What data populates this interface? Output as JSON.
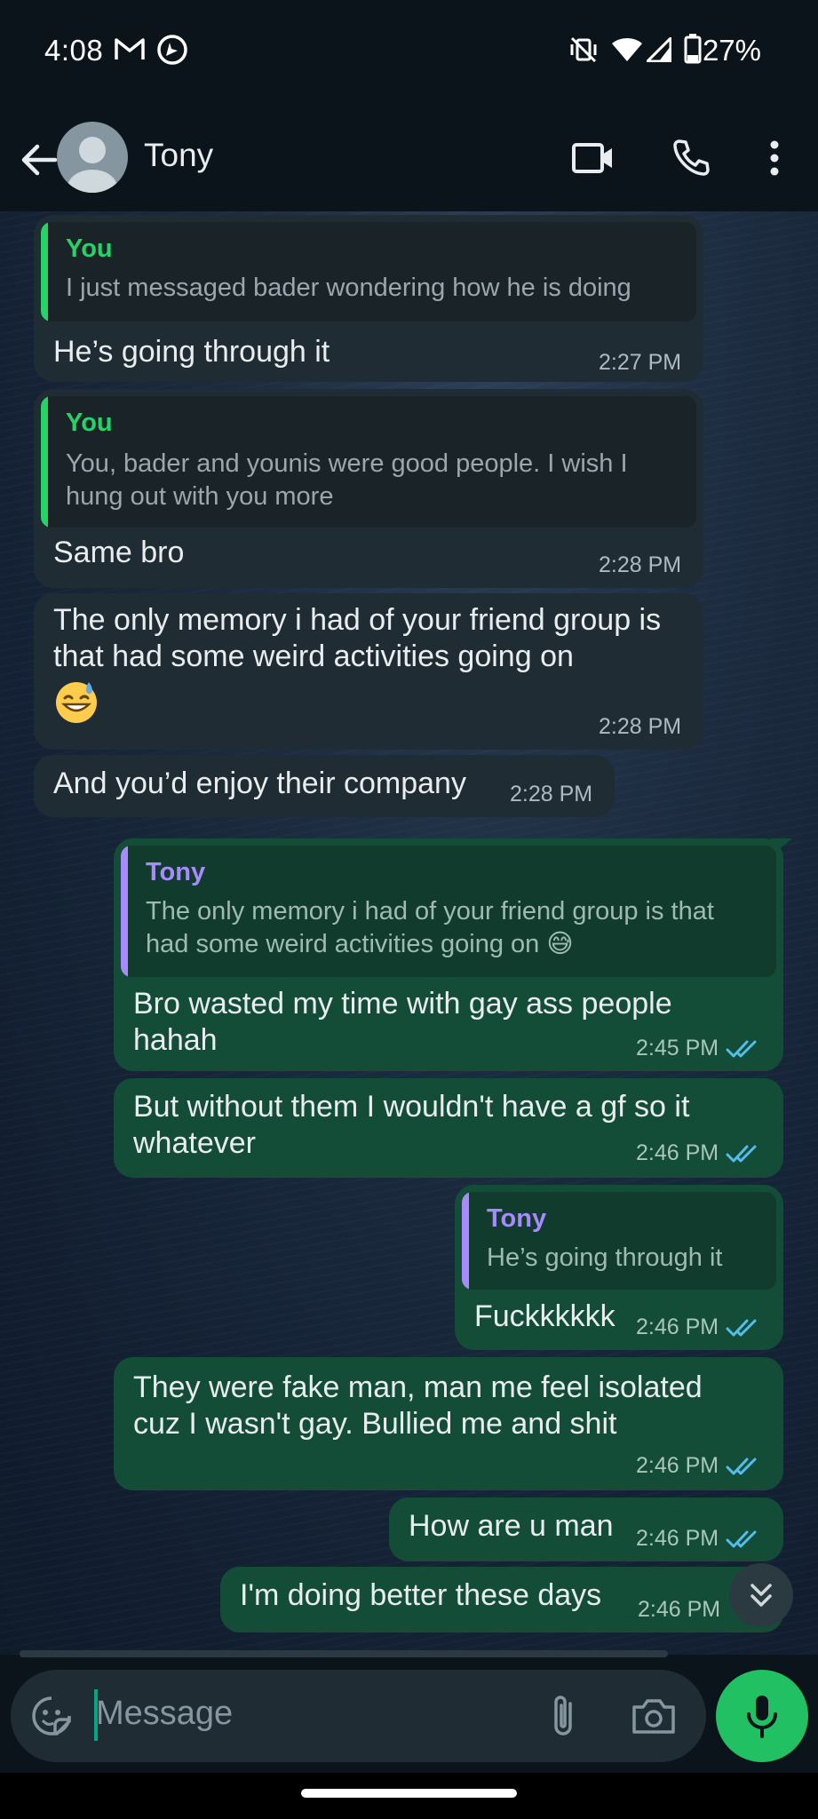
{
  "status_bar": {
    "time": "4:08",
    "battery": "27%"
  },
  "app_bar": {
    "contact_name": "Tony"
  },
  "messages": [
    {
      "dir": "in",
      "quote_author": "You",
      "quote_text": "I just messaged bader wondering how he is doing",
      "text": "He’s going through it",
      "time": "2:27 PM"
    },
    {
      "dir": "in",
      "quote_author": "You",
      "quote_text": "You, bader and younis were good people. I wish I hung out with you more",
      "text": "Same bro",
      "time": "2:28 PM"
    },
    {
      "dir": "in",
      "text": "The only memory i had of your friend group is that had some weird activities going on",
      "emoji": "😅",
      "time": "2:28 PM"
    },
    {
      "dir": "in",
      "text": "And you’d enjoy their company",
      "time": "2:28 PM"
    },
    {
      "dir": "out",
      "quote_author": "Tony",
      "quote_text": "The only memory i had of your friend group is that had some weird activities going on 😅",
      "text": "Bro wasted my time with gay ass people hahah",
      "time": "2:45 PM",
      "status": "read"
    },
    {
      "dir": "out",
      "text": "But without them I wouldn't have a gf so it whatever",
      "time": "2:46 PM",
      "status": "read"
    },
    {
      "dir": "out",
      "quote_author": "Tony",
      "quote_text": "He’s going through it",
      "text": "Fuckkkkkk",
      "time": "2:46 PM",
      "status": "read"
    },
    {
      "dir": "out",
      "text": "They were fake man, man me feel isolated cuz I wasn't gay. Bullied me and shit",
      "time": "2:46 PM",
      "status": "read"
    },
    {
      "dir": "out",
      "text": "How are u man",
      "time": "2:46 PM",
      "status": "read"
    },
    {
      "dir": "out",
      "text": "I'm doing better these days",
      "time": "2:46 PM"
    }
  ],
  "composer": {
    "placeholder": "Message"
  },
  "colors": {
    "incoming_bubble": "#202c33",
    "outgoing_bubble": "#144d37",
    "accent_green": "#21c063",
    "quote_you": "#25d366",
    "quote_tony": "#a78bfa",
    "read_ticks": "#53bdeb"
  },
  "icons": [
    "gmail-icon",
    "navigation-icon",
    "vibrate-off-icon",
    "wifi-icon",
    "signal-icon",
    "battery-icon",
    "back-arrow-icon",
    "avatar-icon",
    "video-call-icon",
    "phone-icon",
    "more-vert-icon",
    "double-check-icon",
    "scroll-down-icon",
    "sticker-icon",
    "attach-icon",
    "camera-icon",
    "mic-icon"
  ]
}
